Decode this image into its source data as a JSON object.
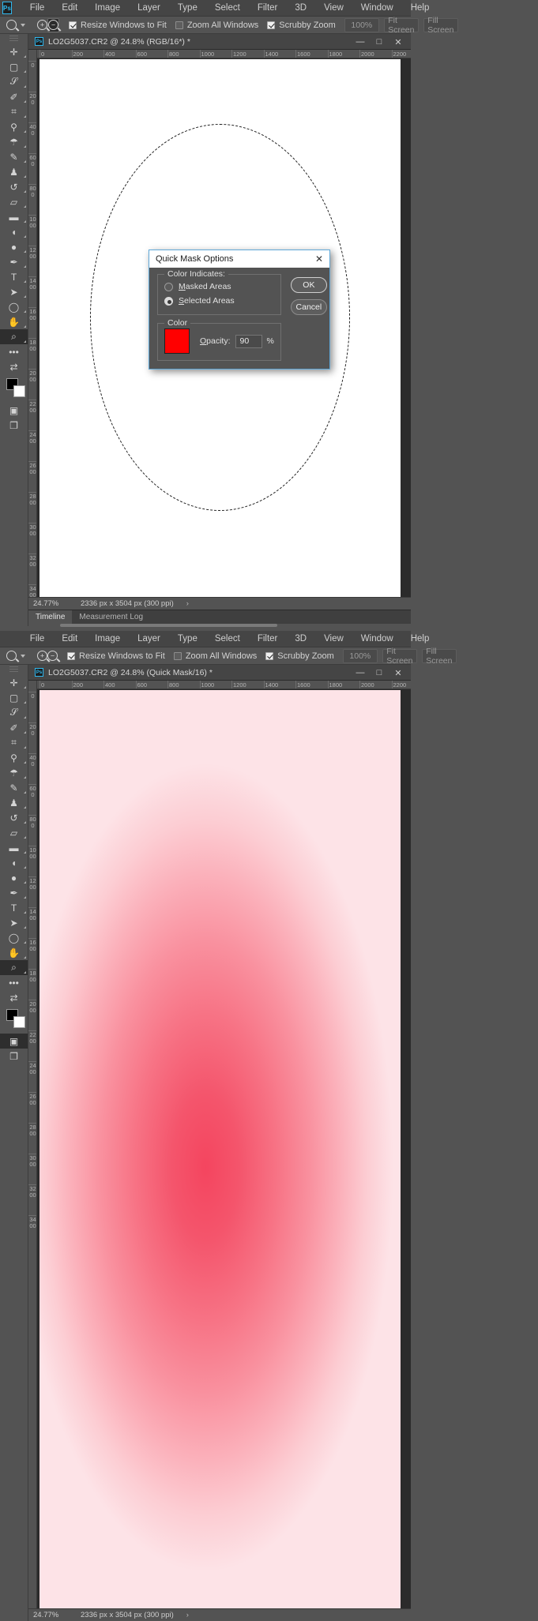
{
  "app": {
    "name": "Adobe Photoshop",
    "logo": "Ps"
  },
  "menu": {
    "items": [
      "File",
      "Edit",
      "Image",
      "Layer",
      "Type",
      "Select",
      "Filter",
      "3D",
      "View",
      "Window",
      "Help"
    ]
  },
  "options_bar": {
    "tool_icon": "zoom-tool-icon",
    "zoom_in_label": "+",
    "zoom_out_label": "−",
    "checkboxes": [
      {
        "label": "Resize Windows to Fit",
        "checked": true
      },
      {
        "label": "Zoom All Windows",
        "checked": false
      },
      {
        "label": "Scrubby Zoom",
        "checked": true
      }
    ],
    "zoom_value": "100%",
    "buttons": [
      "Fit Screen",
      "Fill Screen"
    ]
  },
  "toolbar": {
    "tools": [
      {
        "name": "move-tool",
        "glyph": "✚"
      },
      {
        "name": "rectangular-marquee-tool",
        "glyph": "▢"
      },
      {
        "name": "lasso-tool",
        "glyph": "⊃"
      },
      {
        "name": "quick-selection-tool",
        "glyph": "✐"
      },
      {
        "name": "crop-tool",
        "glyph": "⌗"
      },
      {
        "name": "eyedropper-tool",
        "glyph": "⚗"
      },
      {
        "name": "spot-healing-brush-tool",
        "glyph": "☂"
      },
      {
        "name": "brush-tool",
        "glyph": "✒"
      },
      {
        "name": "clone-stamp-tool",
        "glyph": "♟"
      },
      {
        "name": "history-brush-tool",
        "glyph": "↺"
      },
      {
        "name": "eraser-tool",
        "glyph": "▱"
      },
      {
        "name": "gradient-tool",
        "glyph": "▬"
      },
      {
        "name": "blur-tool",
        "glyph": "◖"
      },
      {
        "name": "dodge-tool",
        "glyph": "●"
      },
      {
        "name": "pen-tool",
        "glyph": "✒"
      },
      {
        "name": "horizontal-type-tool",
        "glyph": "T"
      },
      {
        "name": "path-selection-tool",
        "glyph": "➤"
      },
      {
        "name": "ellipse-tool",
        "glyph": "◯"
      },
      {
        "name": "hand-tool",
        "glyph": "✋"
      },
      {
        "name": "zoom-tool",
        "glyph": "⌕"
      },
      {
        "name": "edit-toolbar-tool",
        "glyph": "•••"
      },
      {
        "name": "swap-colors-icon",
        "glyph": "⇄"
      },
      {
        "name": "quick-mask-mode-toggle",
        "glyph": "▣"
      },
      {
        "name": "screen-mode-toggle",
        "glyph": "❐"
      }
    ],
    "foreground_color": "#000000",
    "background_color": "#ffffff"
  },
  "window_top": {
    "document": {
      "title": "LO2G5037.CR2 @ 24.8% (RGB/16*) *",
      "icon": "Ps"
    },
    "window_buttons": {
      "minimize": "—",
      "maximize": "□",
      "close": "✕"
    },
    "rulers": {
      "horizontal": [
        "0",
        "200",
        "400",
        "600",
        "800",
        "1000",
        "1200",
        "1400",
        "1600",
        "1800",
        "2000",
        "2200"
      ],
      "vertical": [
        "0",
        "200",
        "400",
        "600",
        "800",
        "1000",
        "1200",
        "1400",
        "1600",
        "1800",
        "2000",
        "2200",
        "2400",
        "2600",
        "2800",
        "3000",
        "3200",
        "3400"
      ]
    },
    "status": {
      "zoom": "24.77%",
      "info": "2336 px x 3504 px (300 ppi)",
      "arrow": "›"
    },
    "panel_tabs": [
      {
        "label": "Timeline",
        "active": true
      },
      {
        "label": "Measurement Log",
        "active": false
      }
    ]
  },
  "window_bottom": {
    "document": {
      "title": "LO2G5037.CR2 @ 24.8% (Quick Mask/16) *",
      "icon": "Ps"
    },
    "window_buttons": {
      "minimize": "—",
      "maximize": "□",
      "close": "✕"
    },
    "rulers": {
      "horizontal": [
        "0",
        "200",
        "400",
        "600",
        "800",
        "1000",
        "1200",
        "1400",
        "1600",
        "1800",
        "2000",
        "2200"
      ],
      "vertical": [
        "0",
        "200",
        "400",
        "600",
        "800",
        "1000",
        "1200",
        "1400",
        "1600",
        "1800",
        "2000",
        "2200",
        "2400",
        "2600",
        "2800",
        "3000",
        "3200",
        "3400"
      ]
    },
    "status": {
      "zoom": "24.77%",
      "info": "2336 px x 3504 px (300 ppi)",
      "arrow": "›"
    },
    "quick_mask_overlay_color": "#ff0000"
  },
  "dialog": {
    "title": "Quick Mask Options",
    "close_glyph": "✕",
    "color_indicates": {
      "legend": "Color Indicates:",
      "options": [
        {
          "label": "Masked Areas",
          "mnemonic": "M",
          "selected": false
        },
        {
          "label": "Selected Areas",
          "mnemonic": "S",
          "selected": true
        }
      ]
    },
    "color_section": {
      "legend": "Color",
      "swatch": "#ff0000",
      "opacity_label": "Opacity:",
      "opacity_mnemonic": "O",
      "opacity_value": "90",
      "percent_sign": "%"
    },
    "buttons": [
      {
        "label": "OK",
        "primary": true
      },
      {
        "label": "Cancel",
        "primary": false
      }
    ]
  }
}
